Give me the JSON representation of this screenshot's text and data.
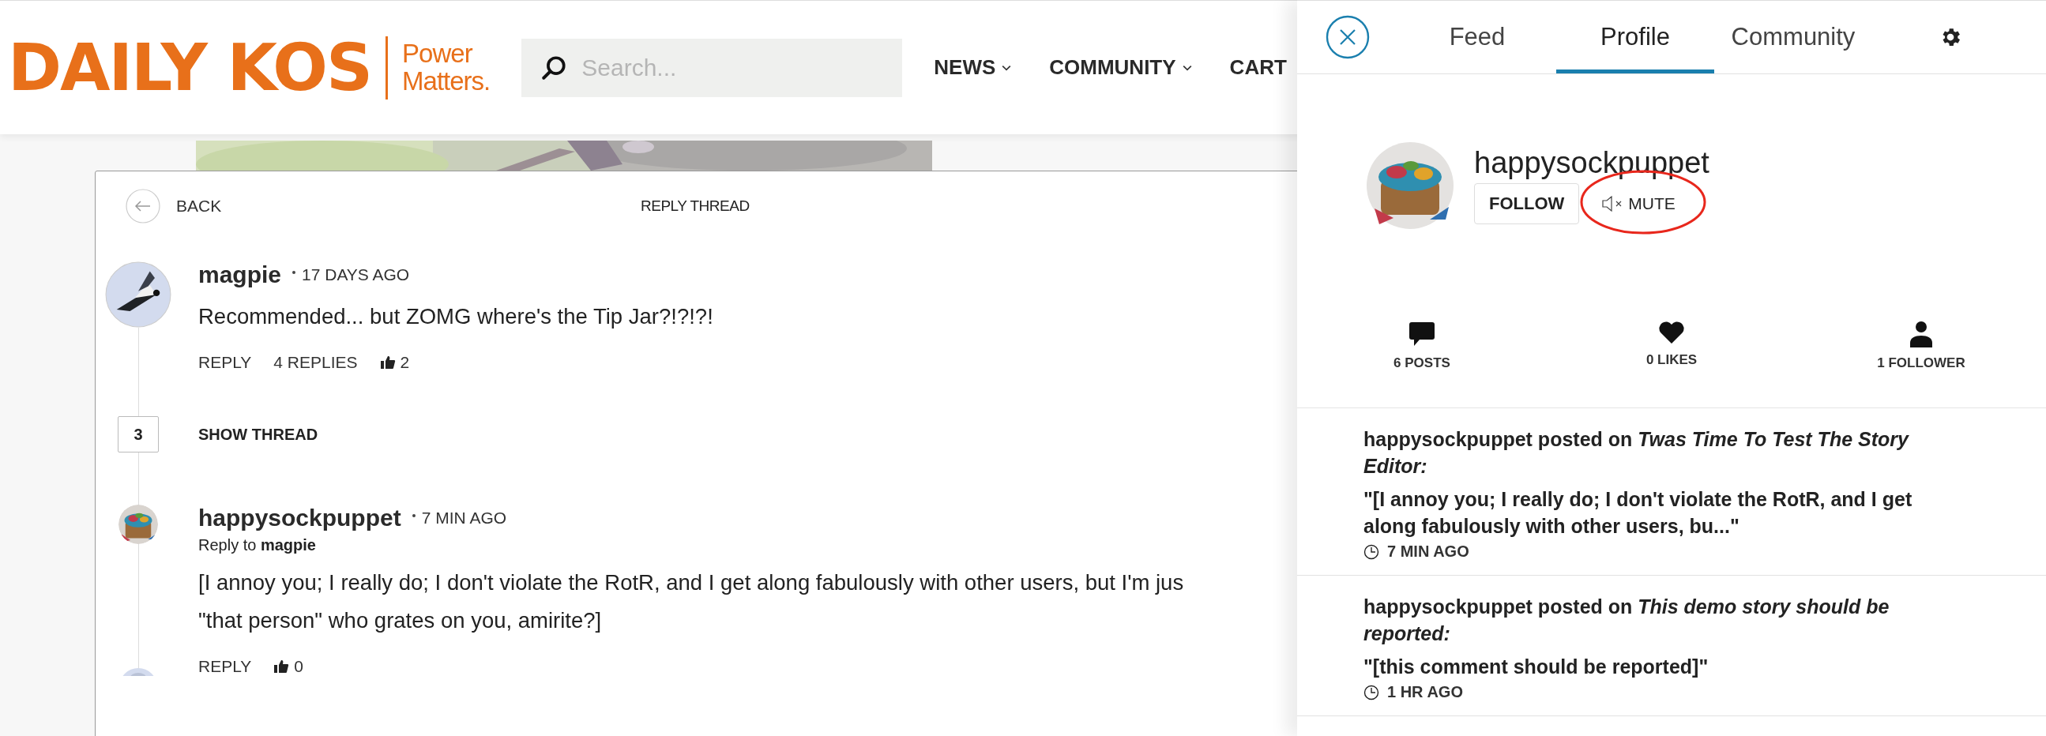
{
  "header": {
    "logo": "DAILY KOS",
    "tagline": [
      "Power",
      "Matters."
    ],
    "search": {
      "placeholder": "Search..."
    },
    "nav": [
      {
        "label": "NEWS",
        "dropdown": true
      },
      {
        "label": "COMMUNITY",
        "dropdown": true
      },
      {
        "label": "CART",
        "dropdown": false
      }
    ]
  },
  "reply_thread": {
    "back": "BACK",
    "title": "REPLY THREAD",
    "items": [
      {
        "kind": "comment",
        "author": "magpie",
        "time": "17 DAYS AGO",
        "text_lines": [
          "Recommended... but ZOMG where's the Tip Jar?!?!?!"
        ],
        "actions": [
          "REPLY",
          "4 REPLIES"
        ],
        "likes": "2"
      },
      {
        "kind": "collapsed",
        "count": "3",
        "label": "SHOW THREAD"
      },
      {
        "kind": "comment",
        "author": "happysockpuppet",
        "time": "7 MIN AGO",
        "reply_to": "Reply to **magpie**",
        "text_lines": [
          "[I annoy you; I really do; I don't violate the RotR, and I get along fabulously with other users, but I'm jus",
          "\"that person\" who grates on you, amirite?]"
        ],
        "actions": [
          "REPLY"
        ],
        "likes": "0"
      }
    ]
  },
  "panel": {
    "tabs": [
      {
        "label": "Feed",
        "selected": false
      },
      {
        "label": "Profile",
        "selected": true
      },
      {
        "label": "Community",
        "selected": false
      }
    ],
    "profile": {
      "username": "happysockpuppet",
      "follow": "FOLLOW",
      "mute": "MUTE",
      "mute_circled": true
    },
    "stats": [
      {
        "kind": "posts",
        "label": "6 POSTS"
      },
      {
        "kind": "likes",
        "label": "0 LIKES"
      },
      {
        "kind": "followers",
        "label": "1 FOLLOWER"
      }
    ],
    "activity": [
      {
        "heading": "happysockpuppet posted on *Twas Time To Test The Story Editor:*",
        "quote": "\"[I annoy you; I really do; I don't violate the RotR, and I get along fabulously with other users, bu...\"",
        "time": "7 MIN AGO"
      },
      {
        "heading": "happysockpuppet posted on *This demo story should be reported:*",
        "quote": "\"[this comment should be reported]\"",
        "time": "1 HR AGO"
      }
    ]
  }
}
